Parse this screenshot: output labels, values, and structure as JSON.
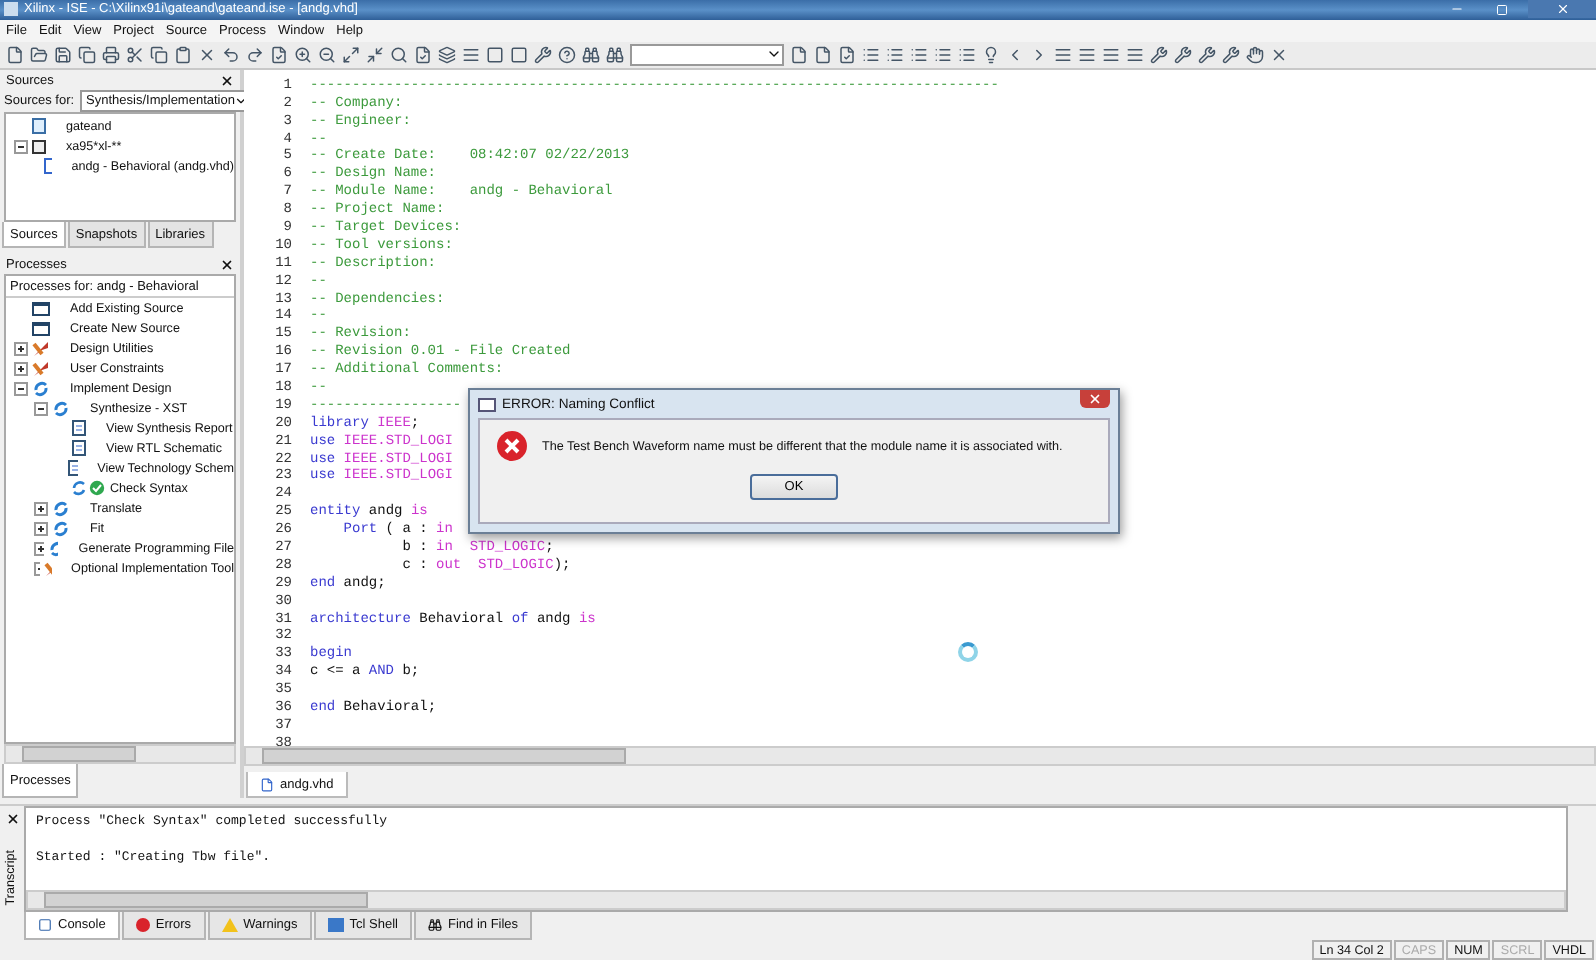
{
  "window": {
    "title": "Xilinx - ISE - C:\\Xilinx91i\\gateand\\gateand.ise - [andg.vhd]"
  },
  "menu": [
    "File",
    "Edit",
    "View",
    "Project",
    "Source",
    "Process",
    "Window",
    "Help"
  ],
  "sources": {
    "title": "Sources",
    "for_label": "Sources for:",
    "for_value": "Synthesis/Implementation",
    "tree": [
      {
        "label": "gateand",
        "kind": "project"
      },
      {
        "label": "xa95*xl-**",
        "kind": "chip",
        "expanded": true,
        "children": [
          {
            "label": "andg - Behavioral (andg.vhd)",
            "kind": "vhdl"
          }
        ]
      }
    ],
    "tabs": [
      {
        "label": "Sources",
        "selected": true
      },
      {
        "label": "Snapshots",
        "selected": false
      },
      {
        "label": "Libraries",
        "selected": false
      }
    ]
  },
  "processes": {
    "title": "Processes",
    "for_label": "Processes for: andg - Behavioral",
    "tree": [
      {
        "label": "Add Existing Source",
        "kind": "doc"
      },
      {
        "label": "Create New Source",
        "kind": "doc"
      },
      {
        "label": "Design Utilities",
        "kind": "tools",
        "expanded": false
      },
      {
        "label": "User Constraints",
        "kind": "tools",
        "expanded": false
      },
      {
        "label": "Implement Design",
        "kind": "run",
        "expanded": true,
        "children": [
          {
            "label": "Synthesize - XST",
            "kind": "run",
            "expanded": true,
            "children": [
              {
                "label": "View Synthesis Report",
                "kind": "report"
              },
              {
                "label": "View RTL Schematic",
                "kind": "report"
              },
              {
                "label": "View Technology Schem",
                "kind": "report"
              },
              {
                "label": "Check Syntax",
                "kind": "done"
              }
            ]
          },
          {
            "label": "Translate",
            "kind": "run",
            "expanded": false
          },
          {
            "label": "Fit",
            "kind": "run",
            "expanded": false
          },
          {
            "label": "Generate Programming File",
            "kind": "run",
            "expanded": false
          },
          {
            "label": "Optional Implementation Tool",
            "kind": "tools",
            "expanded": false
          }
        ]
      }
    ],
    "tab": "Processes"
  },
  "editor": {
    "lines": [
      {
        "number": "1",
        "tokens": [
          {
            "kind": "comment",
            "text": "----------------------------------------------------------------------------------"
          }
        ]
      },
      {
        "number": "2",
        "tokens": [
          {
            "kind": "comment",
            "text": "-- Company:"
          }
        ]
      },
      {
        "number": "3",
        "tokens": [
          {
            "kind": "comment",
            "text": "-- Engineer:"
          }
        ]
      },
      {
        "number": "4",
        "tokens": [
          {
            "kind": "comment",
            "text": "--"
          }
        ]
      },
      {
        "number": "5",
        "tokens": [
          {
            "kind": "comment",
            "text": "-- Create Date:    08:42:07 02/22/2013"
          }
        ]
      },
      {
        "number": "6",
        "tokens": [
          {
            "kind": "comment",
            "text": "-- Design Name:"
          }
        ]
      },
      {
        "number": "7",
        "tokens": [
          {
            "kind": "comment",
            "text": "-- Module Name:    andg - Behavioral"
          }
        ]
      },
      {
        "number": "8",
        "tokens": [
          {
            "kind": "comment",
            "text": "-- Project Name:"
          }
        ]
      },
      {
        "number": "9",
        "tokens": [
          {
            "kind": "comment",
            "text": "-- Target Devices:"
          }
        ]
      },
      {
        "number": "10",
        "tokens": [
          {
            "kind": "comment",
            "text": "-- Tool versions:"
          }
        ]
      },
      {
        "number": "11",
        "tokens": [
          {
            "kind": "comment",
            "text": "-- Description:"
          }
        ]
      },
      {
        "number": "12",
        "tokens": [
          {
            "kind": "comment",
            "text": "--"
          }
        ]
      },
      {
        "number": "13",
        "tokens": [
          {
            "kind": "comment",
            "text": "-- Dependencies:"
          }
        ]
      },
      {
        "number": "14",
        "tokens": [
          {
            "kind": "comment",
            "text": "--"
          }
        ]
      },
      {
        "number": "15",
        "tokens": [
          {
            "kind": "comment",
            "text": "-- Revision:"
          }
        ]
      },
      {
        "number": "16",
        "tokens": [
          {
            "kind": "comment",
            "text": "-- Revision 0.01 - File Created"
          }
        ]
      },
      {
        "number": "17",
        "tokens": [
          {
            "kind": "comment",
            "text": "-- Additional Comments:"
          }
        ]
      },
      {
        "number": "18",
        "tokens": [
          {
            "kind": "comment",
            "text": "--"
          }
        ]
      },
      {
        "number": "19",
        "tokens": [
          {
            "kind": "comment",
            "text": "------------------"
          }
        ]
      },
      {
        "number": "20",
        "tokens": [
          {
            "kind": "keyword",
            "text": "library"
          },
          {
            "kind": "special",
            "text": " IEEE"
          },
          {
            "kind": "plain",
            "text": ";"
          }
        ]
      },
      {
        "number": "21",
        "tokens": [
          {
            "kind": "keyword",
            "text": "use"
          },
          {
            "kind": "special",
            "text": " IEEE.STD_LOGI"
          }
        ]
      },
      {
        "number": "22",
        "tokens": [
          {
            "kind": "keyword",
            "text": "use"
          },
          {
            "kind": "special",
            "text": " IEEE.STD_LOGI"
          }
        ]
      },
      {
        "number": "23",
        "tokens": [
          {
            "kind": "keyword",
            "text": "use"
          },
          {
            "kind": "special",
            "text": " IEEE.STD_LOGI"
          }
        ]
      },
      {
        "number": "24"
      },
      {
        "number": "25",
        "tokens": [
          {
            "kind": "keyword",
            "text": "entity"
          },
          {
            "kind": "plain",
            "text": " andg "
          },
          {
            "kind": "special",
            "text": "is"
          }
        ]
      },
      {
        "number": "26",
        "tokens": [
          {
            "kind": "keyword",
            "text": "    Port"
          },
          {
            "kind": "plain",
            "text": " ( a : "
          },
          {
            "kind": "special",
            "text": "in"
          }
        ]
      },
      {
        "number": "27",
        "tokens": [
          {
            "kind": "plain",
            "text": "           b : "
          },
          {
            "kind": "special",
            "text": "in  STD_LOGIC"
          },
          {
            "kind": "plain",
            "text": ";"
          }
        ]
      },
      {
        "number": "28",
        "tokens": [
          {
            "kind": "plain",
            "text": "           c : "
          },
          {
            "kind": "special",
            "text": "out  STD_LOGIC"
          },
          {
            "kind": "plain",
            "text": ");"
          }
        ]
      },
      {
        "number": "29",
        "tokens": [
          {
            "kind": "keyword",
            "text": "end"
          },
          {
            "kind": "plain",
            "text": " andg;"
          }
        ]
      },
      {
        "number": "30"
      },
      {
        "number": "31",
        "tokens": [
          {
            "kind": "keyword",
            "text": "architecture"
          },
          {
            "kind": "plain",
            "text": " Behavioral "
          },
          {
            "kind": "keyword",
            "text": "of"
          },
          {
            "kind": "plain",
            "text": " andg "
          },
          {
            "kind": "special",
            "text": "is"
          }
        ]
      },
      {
        "number": "32"
      },
      {
        "number": "33",
        "tokens": [
          {
            "kind": "keyword",
            "text": "begin"
          }
        ]
      },
      {
        "number": "34",
        "tokens": [
          {
            "kind": "plain",
            "text": "c <= a "
          },
          {
            "kind": "keyword",
            "text": "AND"
          },
          {
            "kind": "plain",
            "text": " b;"
          }
        ]
      },
      {
        "number": "35"
      },
      {
        "number": "36",
        "tokens": [
          {
            "kind": "keyword",
            "text": "end"
          },
          {
            "kind": "plain",
            "text": " Behavioral;"
          }
        ]
      },
      {
        "number": "37"
      },
      {
        "number": "38"
      }
    ],
    "tabs": [
      {
        "label": "andg.vhd",
        "selected": true
      }
    ]
  },
  "dialog": {
    "title": "ERROR: Naming Conflict",
    "message": "The Test Bench Waveform name must be different that the module name it is associated with.",
    "button": "OK"
  },
  "console": {
    "label": "Transcript",
    "lines": [
      "Process \"Check Syntax\" completed successfully",
      "Started : \"Creating Tbw file\"."
    ],
    "tabs": [
      {
        "label": "Console",
        "kind": "console",
        "selected": true
      },
      {
        "label": "Errors",
        "kind": "errors",
        "selected": false
      },
      {
        "label": "Warnings",
        "kind": "warnings",
        "selected": false
      },
      {
        "label": "Tcl Shell",
        "kind": "tcl",
        "selected": false
      },
      {
        "label": "Find in Files",
        "kind": "find",
        "selected": false
      }
    ]
  },
  "status_bar": [
    {
      "text": "Ln 34 Col 2",
      "on": true
    },
    {
      "text": "CAPS",
      "on": false
    },
    {
      "text": "NUM",
      "on": true
    },
    {
      "text": "SCRL",
      "on": false
    },
    {
      "text": "VHDL",
      "on": true
    }
  ]
}
